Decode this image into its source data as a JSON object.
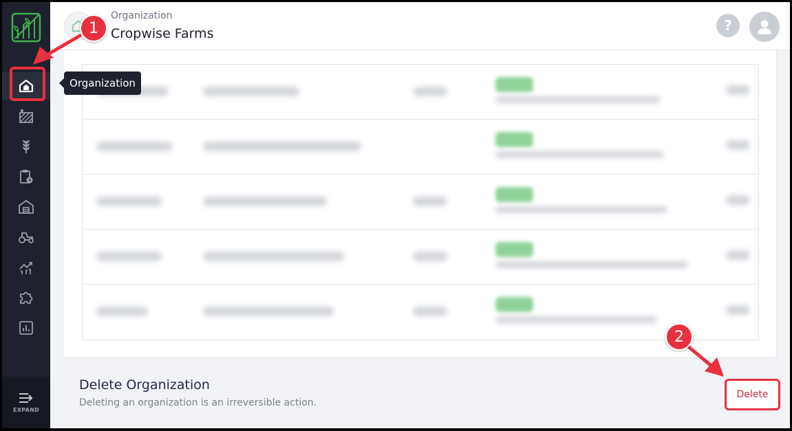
{
  "header": {
    "eyebrow": "Organization",
    "org_name": "Cropwise Farms",
    "help_symbol": "?"
  },
  "sidebar": {
    "items": [
      {
        "icon": "organization-icon",
        "active": true
      },
      {
        "icon": "field-icon"
      },
      {
        "icon": "crop-icon"
      },
      {
        "icon": "task-clipboard-icon"
      },
      {
        "icon": "warehouse-icon"
      },
      {
        "icon": "tractor-icon"
      },
      {
        "icon": "growth-chart-icon"
      },
      {
        "icon": "puzzle-icon"
      },
      {
        "icon": "report-chart-icon"
      }
    ],
    "expand_label": "EXPAND"
  },
  "tooltip": {
    "label": "Organization"
  },
  "delete_section": {
    "title": "Delete Organization",
    "description": "Deleting an organization is an irreversible action.",
    "button_label": "Delete"
  },
  "annotations": {
    "step1": "1",
    "step2": "2"
  },
  "colors": {
    "sidebar": "#1e222e",
    "accent_red": "#e8313f",
    "logo_green": "#3fb24d"
  }
}
